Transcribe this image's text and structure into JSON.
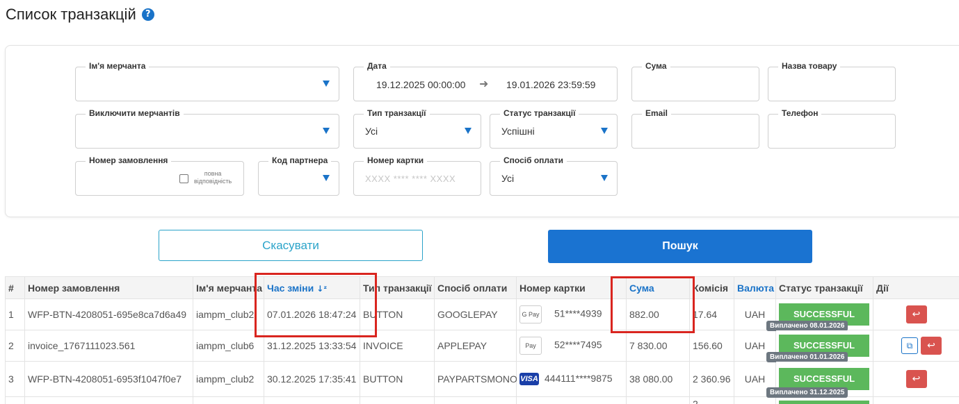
{
  "page": {
    "title": "Список транзакцій",
    "help_icon": "?"
  },
  "filters": {
    "merchant_name": {
      "label": "Ім'я мерчанта",
      "value": ""
    },
    "date": {
      "label": "Дата",
      "from": "19.12.2025 00:00:00",
      "to": "19.01.2026 23:59:59"
    },
    "amount": {
      "label": "Сума",
      "value": ""
    },
    "product_name": {
      "label": "Назва товару",
      "value": ""
    },
    "exclude_merchants": {
      "label": "Виключити мерчантів",
      "value": ""
    },
    "transaction_type": {
      "label": "Тип транзакції",
      "value": "Усі"
    },
    "transaction_status": {
      "label": "Статус транзакції",
      "value": "Успішні"
    },
    "email": {
      "label": "Email",
      "value": ""
    },
    "phone": {
      "label": "Телефон",
      "value": ""
    },
    "order_number": {
      "label": "Номер замовлення",
      "value": "",
      "exact_match_label_1": "повна",
      "exact_match_label_2": "відповідність",
      "exact_match_checked": false
    },
    "partner_code": {
      "label": "Код партнера",
      "value": ""
    },
    "card_number": {
      "label": "Номер картки",
      "placeholder": "XXXX **** **** XXXX"
    },
    "payment_method": {
      "label": "Спосіб оплати",
      "value": "Усі"
    }
  },
  "actions": {
    "cancel_label": "Скасувати",
    "search_label": "Пошук"
  },
  "table": {
    "headers": {
      "num": "#",
      "order": "Номер замовлення",
      "merchant": "Ім'я мерчанта",
      "changed_at": "Час зміни",
      "type": "Тип транзакції",
      "method": "Спосіб оплати",
      "card": "Номер картки",
      "amount": "Сума",
      "fee": "Комісія",
      "currency": "Валюта",
      "status": "Статус транзакції",
      "actions": "Дії"
    },
    "rows": [
      {
        "num": "1",
        "order": "WFP-BTN-4208051-695e8ca7d6a49",
        "merchant": "iampm_club2",
        "changed_at": "07.01.2026 18:47:24",
        "type": "BUTTON",
        "method": "GOOGLEPAY",
        "pay_badge": "G Pay",
        "card": "51****4939",
        "amount": "882.00",
        "fee": "17.64",
        "currency": "UAH",
        "status": "SUCCESSFUL",
        "paid": "Виплачено 08.01.2026"
      },
      {
        "num": "2",
        "order": "invoice_1767111023.561",
        "merchant": "iampm_club6",
        "changed_at": "31.12.2025 13:33:54",
        "type": "INVOICE",
        "method": "APPLEPAY",
        "pay_badge": "Pay",
        "card": "52****7495",
        "amount": "7 830.00",
        "fee": "156.60",
        "currency": "UAH",
        "status": "SUCCESSFUL",
        "paid": "Виплачено 01.01.2026"
      },
      {
        "num": "3",
        "order": "WFP-BTN-4208051-6953f1047f0e7",
        "merchant": "iampm_club2",
        "changed_at": "30.12.2025 17:35:41",
        "type": "BUTTON",
        "method": "PAYPARTSMONO",
        "pay_badge": "VISA",
        "card": "444111****9875",
        "amount": "38 080.00",
        "fee": "2 360.96",
        "currency": "UAH",
        "status": "SUCCESSFUL",
        "paid": "Виплачено 31.12.2025"
      }
    ],
    "partial_row_fee": "2"
  },
  "colors": {
    "accent": "#1a73d1",
    "success": "#5cb85c",
    "danger": "#d9534f",
    "highlight": "#d9251f"
  },
  "icons": {
    "help": "help-circle-icon",
    "caret": "caret-down-icon",
    "date_arrow": "arrow-right-icon",
    "sort": "sort-descending-icon",
    "refund": "undo-arrow-icon",
    "copy": "copy-icon"
  }
}
